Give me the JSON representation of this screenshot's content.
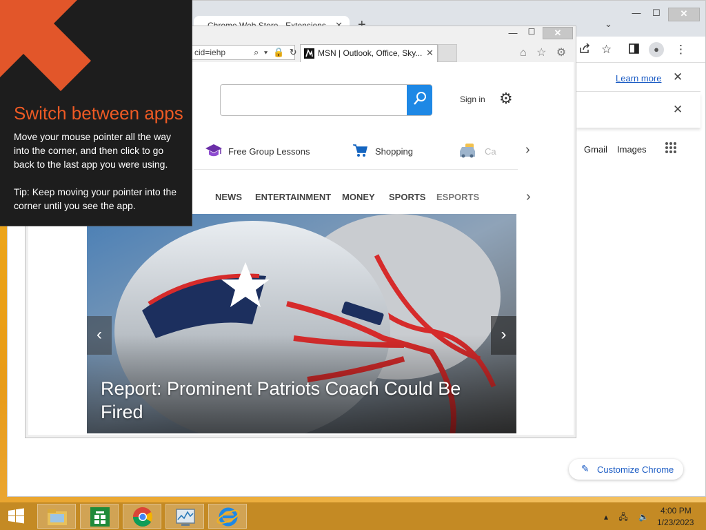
{
  "chrome": {
    "tab_title": "Chrome Web Store - Extensions",
    "tab_close": "✕",
    "new_tab": "+",
    "window_min": "—",
    "window_max": "☐",
    "window_close": "✕",
    "chevron": "⌄",
    "infobar_learn_more": "Learn more",
    "infobar_close": "✕",
    "gmail": "Gmail",
    "images": "Images",
    "customize_label": "Customize Chrome",
    "icons": [
      "share-icon",
      "star-icon",
      "side-panel-icon",
      "profile-icon",
      "menu-icon",
      "apps-icon",
      "pencil-icon"
    ]
  },
  "ie": {
    "address_text": "cid=iehp",
    "addr_icons": "⌕ ▾ 🔒 ↻",
    "tab_title": "MSN | Outlook, Office, Sky...",
    "tab_close": "✕",
    "tab_icon_letter": "⌘",
    "window_min": "—",
    "window_max": "☐",
    "window_close": "✕",
    "nav_icons": "⌂ ☆ ⚙"
  },
  "msn": {
    "search_placeholder": "",
    "signin": "Sign in",
    "quick_links": [
      "Free Group Lessons",
      "Shopping",
      "Ca"
    ],
    "nav": [
      "NEWS",
      "ENTERTAINMENT",
      "MONEY",
      "SPORTS",
      "ESPORTS"
    ],
    "hero_headline": "Report: Prominent Patriots Coach Could Be Fired",
    "hero_prev": "‹",
    "hero_next": "›",
    "next_arrow": "›"
  },
  "tooltip": {
    "title": "Switch between apps",
    "body": "Move your mouse pointer all the way into the corner, and then click to go back to the last app you were using.",
    "tip": "Tip: Keep moving your pointer into the corner until you see the app."
  },
  "taskbar": {
    "apps": [
      "file-explorer",
      "store",
      "chrome",
      "task-manager",
      "internet-explorer"
    ],
    "tray": "▴ 🖧 🔈",
    "time": "4:00 PM",
    "date": "1/23/2023"
  },
  "colors": {
    "tooltip_accent": "#ee5a24",
    "msn_search_blue": "#1e88e5",
    "chrome_link": "#1a5bc4",
    "taskbar": "#c48a24"
  }
}
